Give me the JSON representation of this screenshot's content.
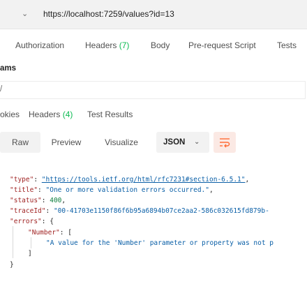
{
  "url_bar": {
    "chevron": "⌄",
    "url": "https://localhost:7259/values?id=13"
  },
  "request_tabs": [
    {
      "label": "Authorization",
      "count": ""
    },
    {
      "label": "Headers ",
      "count": "(7)"
    },
    {
      "label": "Body",
      "count": ""
    },
    {
      "label": "Pre-request Script",
      "count": ""
    },
    {
      "label": "Tests",
      "count": ""
    }
  ],
  "params": {
    "label": "ams",
    "row_text": "/"
  },
  "response_tabs": [
    {
      "label": "okies",
      "count": ""
    },
    {
      "label": "Headers ",
      "count": "(4)"
    },
    {
      "label": "Test Results",
      "count": ""
    }
  ],
  "view_toolbar": {
    "raw": "Raw",
    "preview": "Preview",
    "visualize": "Visualize",
    "format": "JSON",
    "format_chevron": "⌄",
    "wrap_icon": "wrap-lines-icon"
  },
  "response_body": {
    "type_key": "\"type\"",
    "type_value": "\"https://tools.ietf.org/html/rfc7231#section-6.5.1\"",
    "title_key": "\"title\"",
    "title_value": "\"One or more validation errors occurred.\"",
    "status_key": "\"status\"",
    "status_value": "400",
    "traceid_key": "\"traceId\"",
    "traceid_value": "\"00-41703e1150f86f6b95a6894b07ce2aa2-586c032615fd879b-",
    "errors_key": "\"errors\"",
    "number_key": "\"Number\"",
    "number_message": "\"A value for the 'Number' parameter or property was not p"
  },
  "colors": {
    "accent": "#ff6c37",
    "count": "#0cbb52",
    "json_key": "#a02323",
    "json_string": "#0a5fa7",
    "json_number": "#0a7d3c"
  }
}
